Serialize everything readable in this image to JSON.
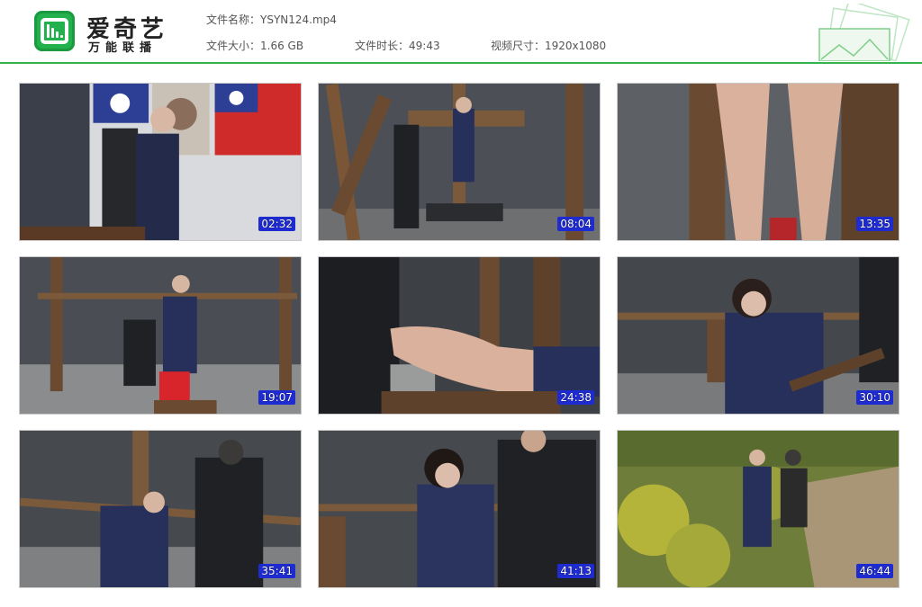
{
  "brand": {
    "name": "爱奇艺",
    "subtitle": "万能联播",
    "logo_icon": "tv-play-icon",
    "accent_color": "#22b14c"
  },
  "meta": {
    "file_name_label": "文件名称：",
    "file_name": "YSYN124.mp4",
    "file_size_label": "文件大小：",
    "file_size": "1.66 GB",
    "duration_label": "文件时长：",
    "duration": "49:43",
    "resolution_label": "视频尺寸：",
    "resolution": "1920x1080"
  },
  "thumbnails": [
    {
      "timestamp": "02:32"
    },
    {
      "timestamp": "08:04"
    },
    {
      "timestamp": "13:35"
    },
    {
      "timestamp": "19:07"
    },
    {
      "timestamp": "24:38"
    },
    {
      "timestamp": "30:10"
    },
    {
      "timestamp": "35:41"
    },
    {
      "timestamp": "41:13"
    },
    {
      "timestamp": "46:44"
    }
  ]
}
